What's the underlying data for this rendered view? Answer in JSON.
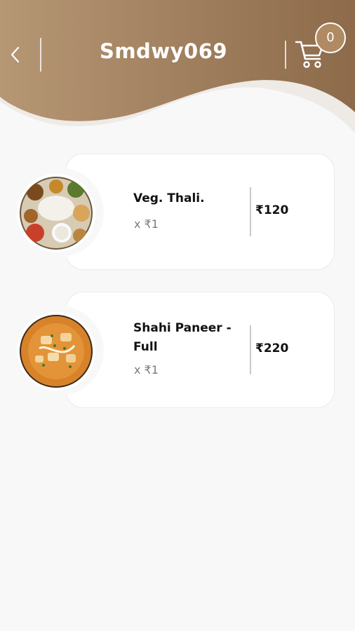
{
  "header": {
    "title": "Smdwy069",
    "cart_count": "0",
    "back_icon": "chevron-left-icon",
    "cart_icon": "shopping-cart-icon"
  },
  "colors": {
    "header_gradient_start": "#b69774",
    "header_gradient_end": "#8c6a4a",
    "card_background": "#ffffff",
    "page_background": "#f8f8f8"
  },
  "cart_items": [
    {
      "name": "Veg. Thali.",
      "quantity": "x ₹1",
      "price": "₹120"
    },
    {
      "name": "Shahi Paneer - Full",
      "quantity": "x ₹1",
      "price": "₹220"
    }
  ]
}
